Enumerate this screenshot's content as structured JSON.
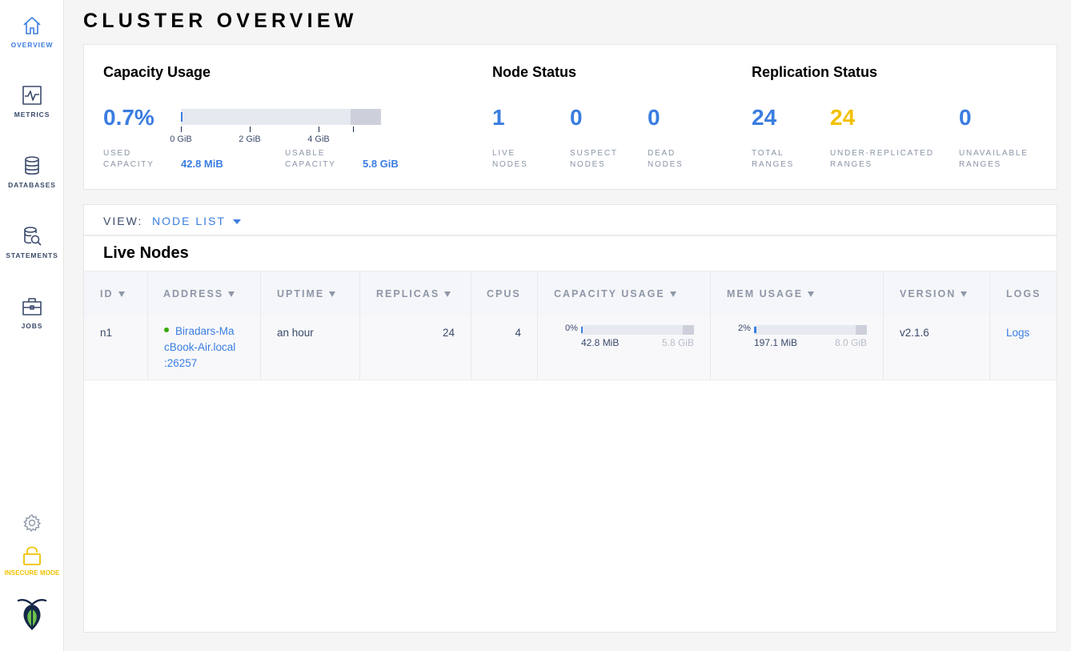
{
  "nav": {
    "items": [
      {
        "label": "OVERVIEW",
        "icon": "home-icon"
      },
      {
        "label": "METRICS",
        "icon": "metrics-icon"
      },
      {
        "label": "DATABASES",
        "icon": "database-icon"
      },
      {
        "label": "STATEMENTS",
        "icon": "statements-icon"
      },
      {
        "label": "JOBS",
        "icon": "briefcase-icon"
      }
    ],
    "settings_icon": "gear-icon",
    "insecure_label": "INSECURE MODE",
    "logo": "cockroachdb-logo"
  },
  "page": {
    "title": "CLUSTER OVERVIEW"
  },
  "capacity": {
    "title": "Capacity Usage",
    "percent": "0.7%",
    "used_fraction": 0.007,
    "ticks": [
      "0 GiB",
      "2 GiB",
      "4 GiB"
    ],
    "used_label": "USED CAPACITY",
    "used_value": "42.8 MiB",
    "usable_label": "USABLE CAPACITY",
    "usable_value": "5.8 GiB"
  },
  "node_status": {
    "title": "Node Status",
    "live": "1",
    "live_label": "LIVE NODES",
    "suspect": "0",
    "suspect_label": "SUSPECT NODES",
    "dead": "0",
    "dead_label": "DEAD NODES"
  },
  "replication": {
    "title": "Replication Status",
    "total": "24",
    "total_label": "TOTAL RANGES",
    "under": "24",
    "under_label": "UNDER-REPLICATED RANGES",
    "unavailable": "0",
    "unavailable_label": "UNAVAILABLE RANGES"
  },
  "view": {
    "label": "VIEW:",
    "selected": "NODE LIST"
  },
  "live_nodes": {
    "title": "Live Nodes",
    "columns": [
      "ID",
      "ADDRESS",
      "UPTIME",
      "REPLICAS",
      "CPUS",
      "CAPACITY USAGE",
      "MEM USAGE",
      "VERSION",
      "LOGS"
    ],
    "rows": [
      {
        "id": "n1",
        "address_lines": [
          "Biradars-Ma",
          "cBook-Air.local",
          ":26257"
        ],
        "status": "live",
        "uptime": "an hour",
        "replicas": "24",
        "cpus": "4",
        "capacity": {
          "percent": "0%",
          "fraction": 0.0,
          "used": "42.8 MiB",
          "total": "5.8 GiB"
        },
        "mem": {
          "percent": "2%",
          "fraction": 0.02,
          "used": "197.1 MiB",
          "total": "8.0 GiB"
        },
        "version": "v2.1.6",
        "logs": "Logs"
      }
    ]
  },
  "colors": {
    "accent": "#3a7de1",
    "warning": "#f2c100",
    "live": "#37a806"
  }
}
